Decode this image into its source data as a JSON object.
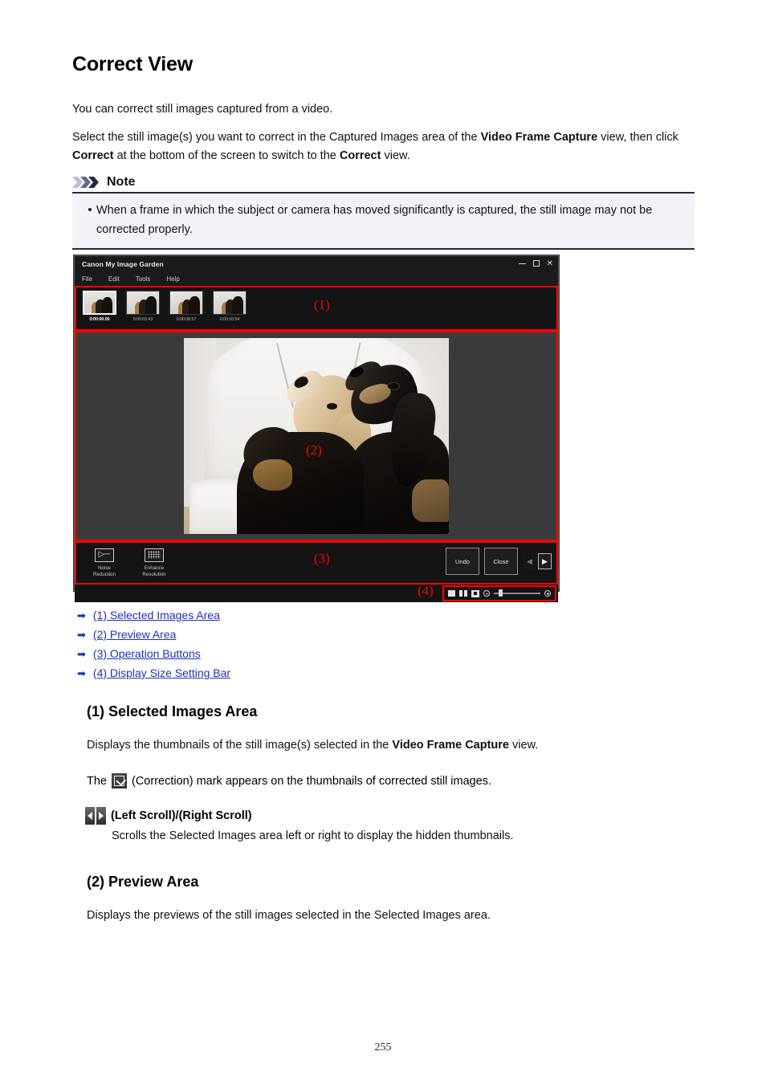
{
  "document": {
    "title": "Correct View",
    "intro": "You can correct still images captured from a video.",
    "select_instruction_1": "Select the still image(s) you want to correct in the Captured Images area of the ",
    "select_instruction_bold_1": "Video Frame Capture",
    "select_instruction_2": " view, then click ",
    "select_instruction_bold_2": "Correct",
    "select_instruction_3": " at the bottom of the screen to switch to the ",
    "select_instruction_bold_3": "Correct",
    "select_instruction_4": " view.",
    "page_number": "255"
  },
  "note": {
    "icon": "triple-chevron-icon",
    "title": "Note",
    "bullet": "•",
    "text": "When a frame in which the subject or camera has moved significantly is captured, the still image may not be corrected properly."
  },
  "app": {
    "window_title": "Canon My Image Garden",
    "window_controls": {
      "minimize": "minimize-icon",
      "maximize": "maximize-icon",
      "close": "✕"
    },
    "menu": [
      {
        "label": "File"
      },
      {
        "label": "Edit"
      },
      {
        "label": "Tools"
      },
      {
        "label": "Help"
      }
    ],
    "selected_images": {
      "callout": "(1)",
      "thumbnails": [
        {
          "time": "0:00:00.00",
          "selected": true
        },
        {
          "time": "0:00:03.43",
          "selected": false
        },
        {
          "time": "0:00:08.57",
          "selected": false
        },
        {
          "time": "0:00:10.54",
          "selected": false
        }
      ]
    },
    "preview": {
      "callout": "(2)"
    },
    "operations": {
      "callout": "(3)",
      "tools": [
        {
          "label_line1": "Noise",
          "label_line2": "Reduction",
          "icon": "noise-reduction-icon"
        },
        {
          "label_line1": "Enhance",
          "label_line2": "Resolution",
          "icon": "enhance-resolution-icon"
        }
      ],
      "undo_label": "Undo",
      "close_label": "Close",
      "scroll_left_icon": "left-scroll-icon",
      "scroll_right_icon": "right-scroll-icon"
    },
    "display_size_bar": {
      "callout": "(4)",
      "icons": [
        "single-view-icon",
        "dual-view-icon",
        "whole-image-icon",
        "zoom-out-icon",
        "zoom-slider",
        "zoom-in-icon"
      ]
    }
  },
  "links": [
    {
      "arrow": "➡",
      "label": "(1) Selected Images Area"
    },
    {
      "arrow": "➡",
      "label": "(2) Preview Area"
    },
    {
      "arrow": "➡",
      "label": "(3) Operation Buttons"
    },
    {
      "arrow": "➡",
      "label": "(4) Display Size Setting Bar"
    }
  ],
  "sections": {
    "selected_images": {
      "heading": "(1) Selected Images Area",
      "desc_1": "Displays the thumbnails of the still image(s) selected in the ",
      "desc_bold": "Video Frame Capture",
      "desc_2": " view.",
      "correction_prefix": "The",
      "correction_icon": "correction-mark-icon",
      "correction_suffix": "(Correction) mark appears on the thumbnails of corrected still images.",
      "scroll_label": "(Left Scroll)/(Right Scroll)",
      "scroll_desc": "Scrolls the Selected Images area left or right to display the hidden thumbnails."
    },
    "preview": {
      "heading": "(2) Preview Area",
      "desc": "Displays the previews of the still images selected in the Selected Images area."
    }
  },
  "colors": {
    "callout_red": "#f00505",
    "link_blue": "#1f2fc4",
    "note_rule": "#232a48",
    "note_bg": "#f1f3f9"
  }
}
